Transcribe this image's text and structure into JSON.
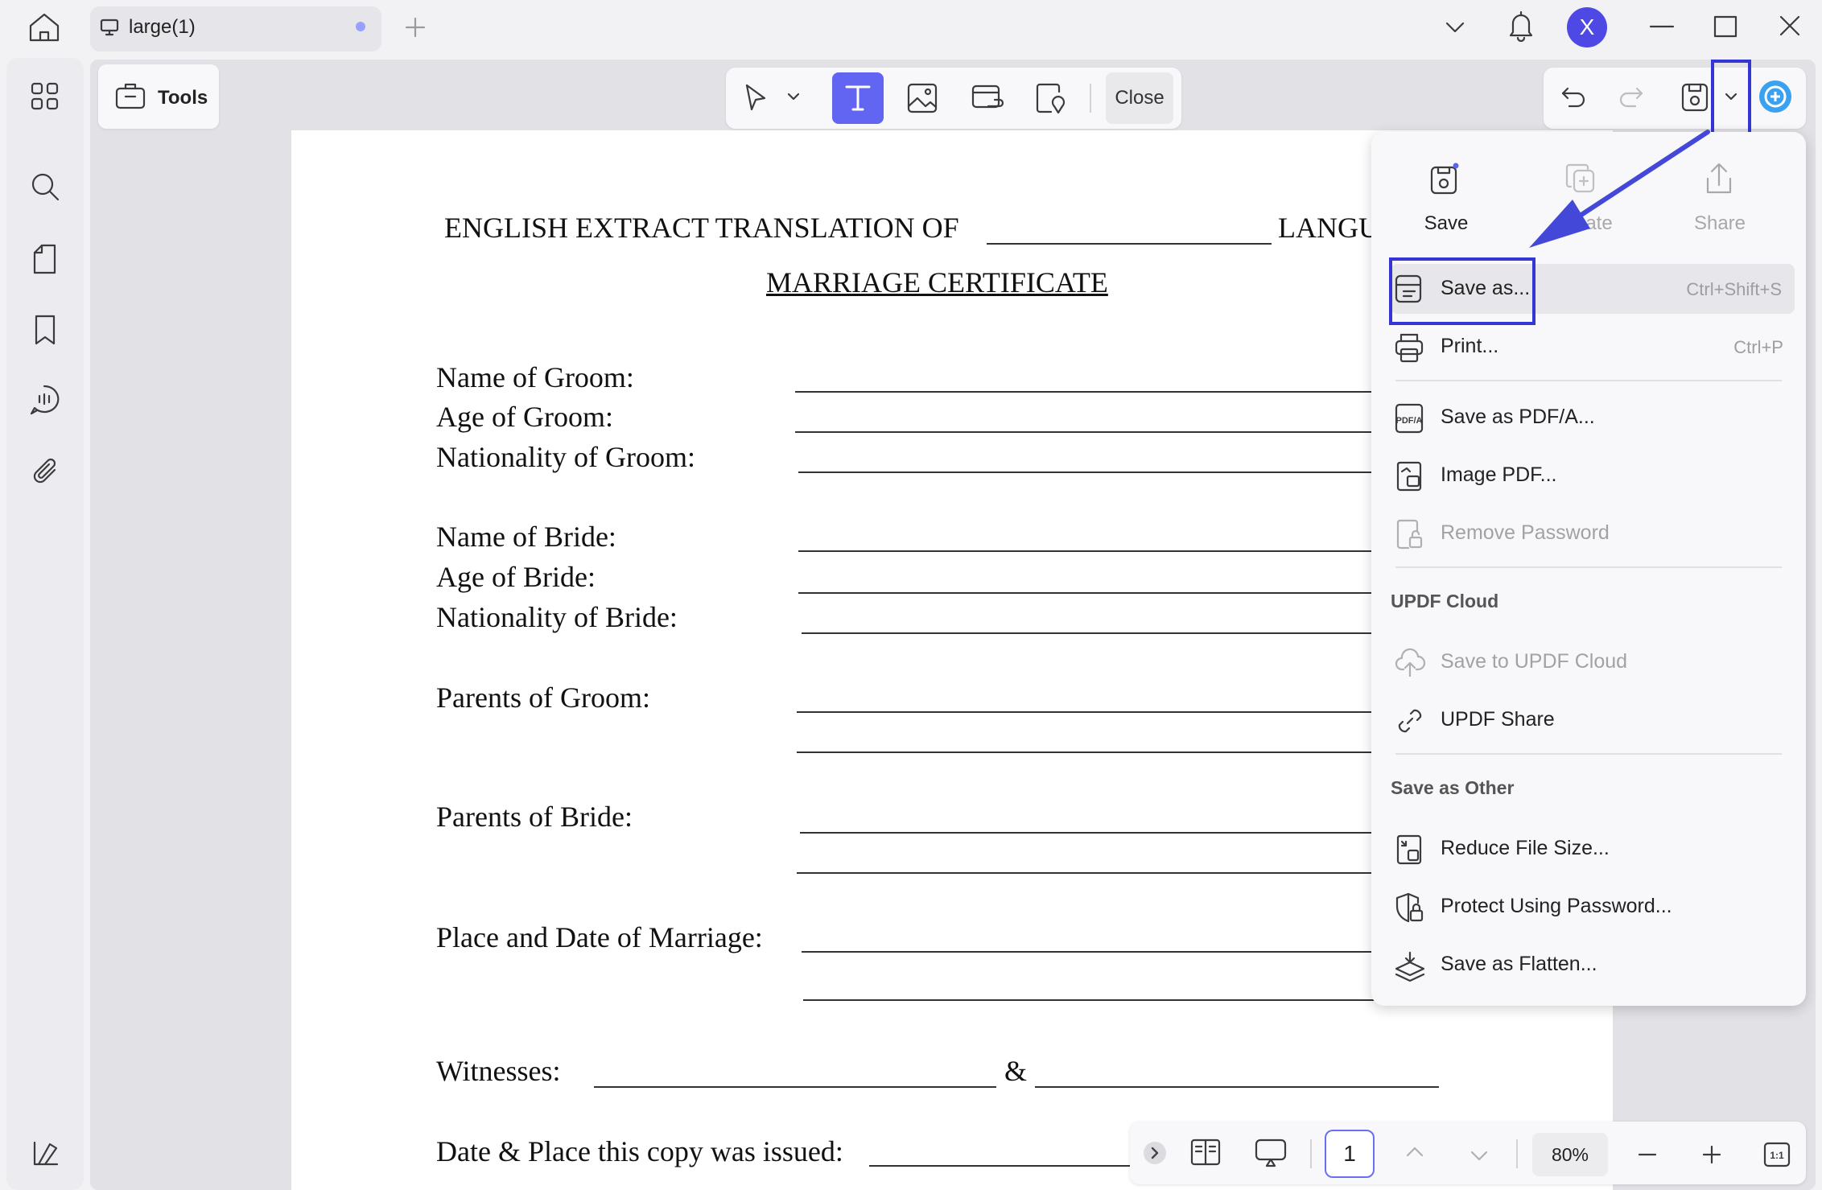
{
  "tab": {
    "title": "large(1)"
  },
  "user": {
    "avatar_letter": "X"
  },
  "toolbar": {
    "tools_label": "Tools",
    "close_label": "Close"
  },
  "document": {
    "title_left": "ENGLISH EXTRACT TRANSLATION OF",
    "title_right": "LANGU",
    "subtitle": "MARRIAGE CERTIFICATE",
    "fields": {
      "name_groom": "Name of Groom:",
      "age_groom": "Age of Groom:",
      "nat_groom": "Nationality of Groom:",
      "name_bride": "Name of Bride:",
      "age_bride": "Age of Bride:",
      "nat_bride": "Nationality of Bride:",
      "parents_groom": "Parents of Groom:",
      "parents_bride": "Parents of Bride:",
      "place_date": "Place and Date of Marriage:",
      "witnesses": "Witnesses:",
      "ampersand": "&",
      "issued": "Date & Place this copy was issued:"
    }
  },
  "save_menu": {
    "top_actions": {
      "save": "Save",
      "duplicate": "plicate",
      "share": "Share"
    },
    "save_as": {
      "label": "Save as...",
      "shortcut": "Ctrl+Shift+S"
    },
    "print": {
      "label": "Print...",
      "shortcut": "Ctrl+P"
    },
    "save_pdfa": "Save as PDF/A...",
    "image_pdf": "Image PDF...",
    "remove_password": "Remove Password",
    "cloud_header": "UPDF Cloud",
    "save_cloud": "Save to UPDF Cloud",
    "updf_share": "UPDF Share",
    "other_header": "Save as Other",
    "reduce": "Reduce File Size...",
    "protect": "Protect Using Password...",
    "flatten": "Save as Flatten..."
  },
  "pager": {
    "page": "1",
    "zoom": "80%"
  },
  "colors": {
    "accent": "#6264f2",
    "highlight": "#3535d6",
    "avatar": "#4e49e4"
  }
}
